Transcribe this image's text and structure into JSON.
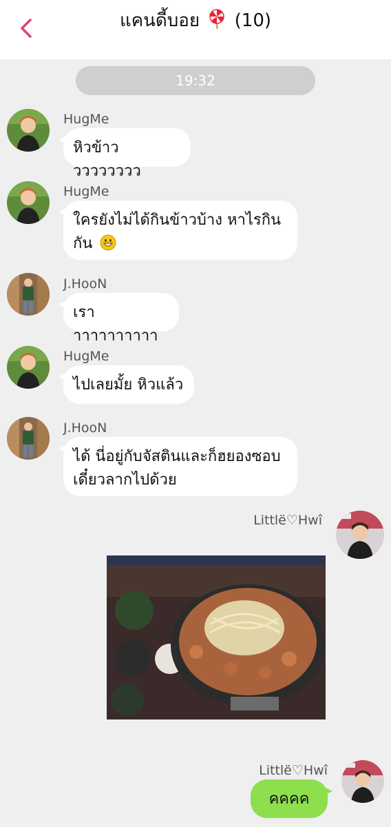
{
  "header": {
    "back_icon": "chevron-left-icon",
    "title_name": "แคนดี้บอย",
    "title_emoji": "lollipop-icon",
    "title_count": "(10)",
    "accent_color": "#e0407a"
  },
  "chat": {
    "time": "19:32",
    "messages": [
      {
        "sender": "HugMe",
        "text": "หิวข้าววววววววว"
      },
      {
        "sender": "HugMe",
        "text_line1": "ใครยังไม่ได้กินข้าวบ้าง หาไรกิน",
        "text_line2": "กัน",
        "emoji": "grinning-face-icon"
      },
      {
        "sender": "J.HooN",
        "text": "เราาาาาาาาาาา"
      },
      {
        "sender": "HugMe",
        "text": "ไปเลยมั้ย หิวแล้ว"
      },
      {
        "sender": "J.HooN",
        "text_line1": "ได้ นี่อยู่กับจัสตินและก็ฮยองซอบ",
        "text_line2": "เดี๋ยวลากไปด้วย"
      },
      {
        "sender": "Littlë♡Hwî",
        "type": "photo"
      },
      {
        "sender": "Littlë♡Hwî",
        "text": "คคคค",
        "bubble_color": "#8ddf4d"
      }
    ]
  }
}
